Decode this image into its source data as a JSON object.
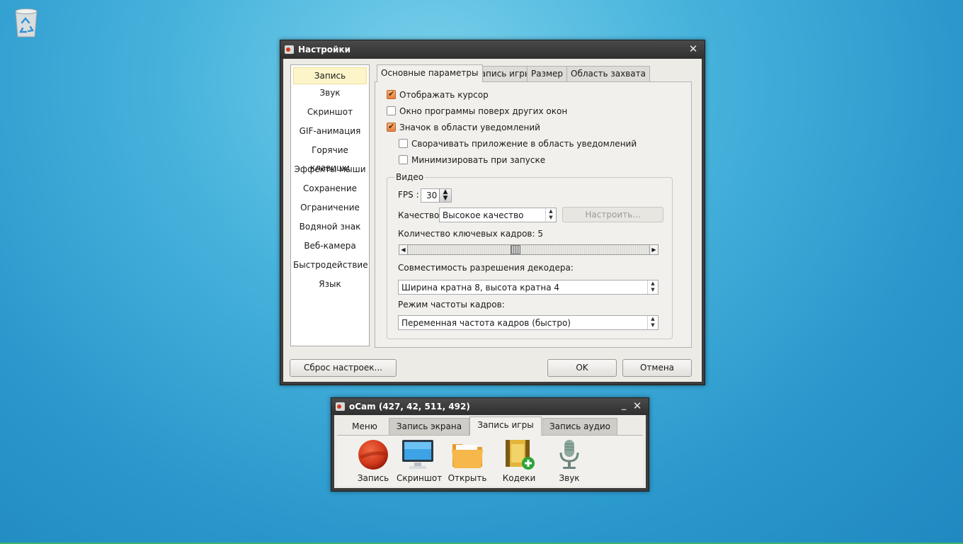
{
  "desktop": {
    "recycle_bin_icon": "recycle-bin-icon"
  },
  "settings": {
    "title": "Настройки",
    "categories": [
      "Запись",
      "Звук",
      "Скриншот",
      "GIF-анимация",
      "Горячие клавиши",
      "Эффекты мыши",
      "Сохранение",
      "Ограничение",
      "Водяной знак",
      "Веб-камера",
      "Быстродействие",
      "Язык"
    ],
    "selected_category": "Запись",
    "tabs": [
      "Основные параметры",
      "Запись игры",
      "Размер",
      "Область захвата"
    ],
    "active_tab": "Основные параметры",
    "options": {
      "show_cursor": {
        "label": "Отображать курсор",
        "checked": true
      },
      "always_on_top": {
        "label": "Окно программы поверх других окон",
        "checked": false
      },
      "tray_icon": {
        "label": "Значок в области уведомлений",
        "checked": true
      },
      "minimize_to_tray": {
        "label": "Сворачивать приложение в область уведомлений",
        "checked": false
      },
      "minimize_on_start": {
        "label": "Минимизировать при запуске",
        "checked": false
      }
    },
    "video": {
      "legend": "Видео",
      "fps_label": "FPS :",
      "fps_value": "30",
      "quality_label": "Качество:",
      "quality_value": "Высокое качество",
      "configure_button": "Настроить...",
      "keyframes_label": "Количество ключевых кадров: 5",
      "keyframes_value": 5,
      "decoder_label": "Совместимость разрешения декодера:",
      "decoder_value": "Ширина кратна 8, высота кратна 4",
      "framerate_mode_label": "Режим частоты кадров:",
      "framerate_mode_value": "Переменная частота кадров (быстро)"
    },
    "buttons": {
      "reset": "Сброс настроек...",
      "ok": "OK",
      "cancel": "Отмена"
    }
  },
  "ocam": {
    "title": "oCam (427, 42, 511, 492)",
    "tabs": [
      "Меню",
      "Запись экрана",
      "Запись игры",
      "Запись аудио"
    ],
    "active_tab": "Запись игры",
    "tools": [
      "Запись",
      "Скриншот",
      "Открыть",
      "Кодеки",
      "Звук"
    ]
  },
  "colors": {
    "accent_orange": "#e4823c",
    "title_bar": "#3c3c3c",
    "panel_bg": "#f1f0ec",
    "selected_item": "#fdf5c9"
  }
}
